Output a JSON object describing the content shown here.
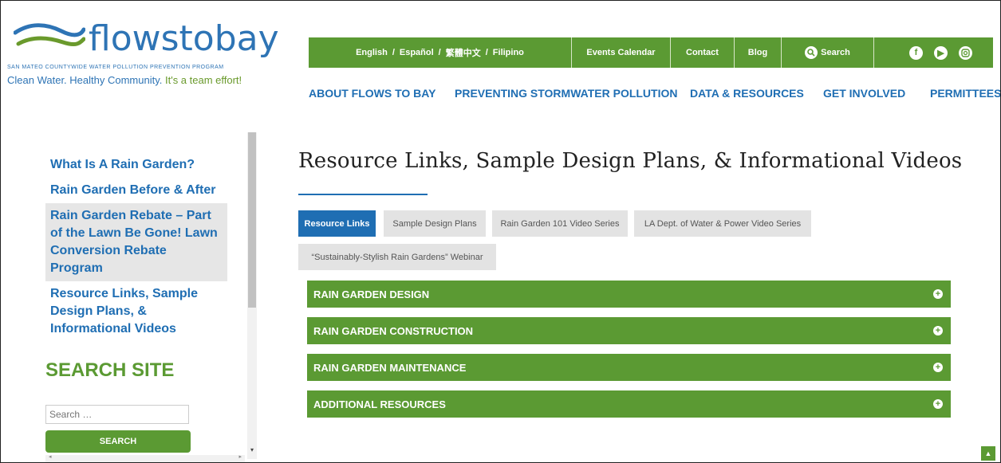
{
  "logo": {
    "word": "flowstobay",
    "subtitle": "SAN MATEO COUNTYWIDE WATER POLLUTION PREVENTION PROGRAM",
    "tagline_blue": "Clean Water. Healthy Community.",
    "tagline_green": "It's a team effort!"
  },
  "topbar": {
    "lang_english": "English",
    "lang_espanol": "Español",
    "lang_chinese": "繁體中文",
    "lang_filipino": "Filipino",
    "separator": "/",
    "events": "Events Calendar",
    "contact": "Contact",
    "blog": "Blog",
    "search": "Search"
  },
  "nav": {
    "about": "ABOUT FLOWS TO BAY",
    "preventing": "PREVENTING STORMWATER POLLUTION",
    "data": "DATA & RESOURCES",
    "involved": "GET INVOLVED",
    "permittees": "PERMITTEES"
  },
  "sidebar": {
    "items": [
      {
        "label": "What Is A Rain Garden?"
      },
      {
        "label": "Rain Garden Before & After"
      },
      {
        "label": "Rain Garden Rebate – Part of the Lawn Be Gone! Lawn Conversion Rebate Program"
      },
      {
        "label": "Resource Links, Sample Design Plans, & Informational Videos"
      }
    ],
    "search_title": "SEARCH SITE",
    "search_placeholder": "Search …",
    "search_button": "SEARCH"
  },
  "main": {
    "title": "Resource Links, Sample Design Plans, & Informational Videos",
    "tabs": [
      {
        "label": "Resource Links"
      },
      {
        "label": "Sample Design Plans"
      },
      {
        "label": "Rain Garden 101 Video Series"
      },
      {
        "label": "LA Dept. of Water & Power Video Series"
      },
      {
        "label": "“Sustainably-Stylish Rain Gardens” Webinar"
      }
    ],
    "accordions": [
      {
        "label": "RAIN GARDEN DESIGN"
      },
      {
        "label": "RAIN GARDEN CONSTRUCTION"
      },
      {
        "label": "RAIN GARDEN MAINTENANCE"
      },
      {
        "label": "ADDITIONAL RESOURCES"
      }
    ]
  },
  "colors": {
    "green": "#5b9a33",
    "blue": "#1f6eb3"
  }
}
